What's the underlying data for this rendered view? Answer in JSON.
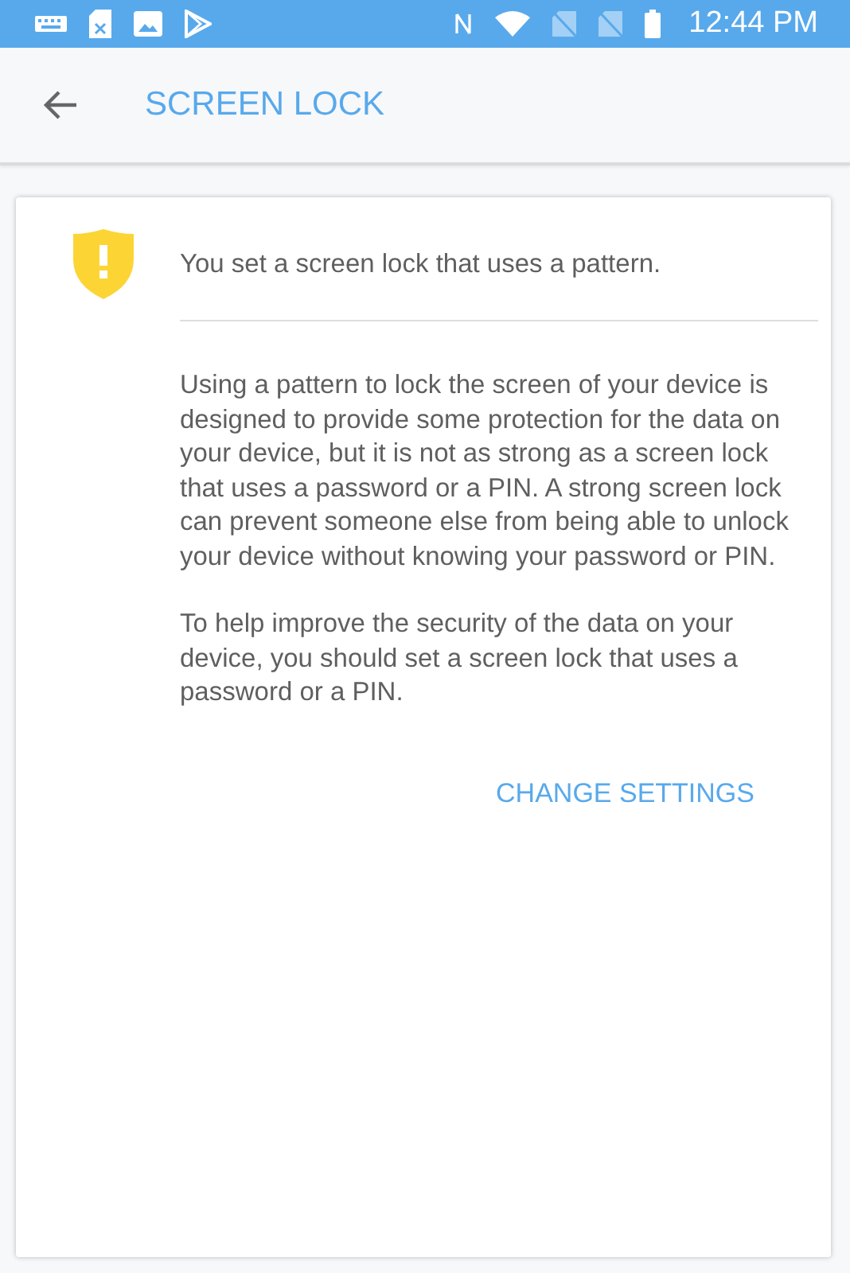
{
  "status_bar": {
    "time": "12:44 PM"
  },
  "app_bar": {
    "title": "SCREEN LOCK"
  },
  "card": {
    "heading": "You set a screen lock that uses a pattern.",
    "paragraphs": [
      "Using a pattern to lock the screen of your device is designed to provide some protection for the data on your device, but it is not as strong as a screen lock that uses a password or a PIN. A strong screen lock can prevent someone else from being able to unlock your device without knowing your password or PIN.",
      "To help improve the security of the data on your device, you should set a screen lock that uses a password or a PIN."
    ],
    "action": "CHANGE SETTINGS"
  }
}
